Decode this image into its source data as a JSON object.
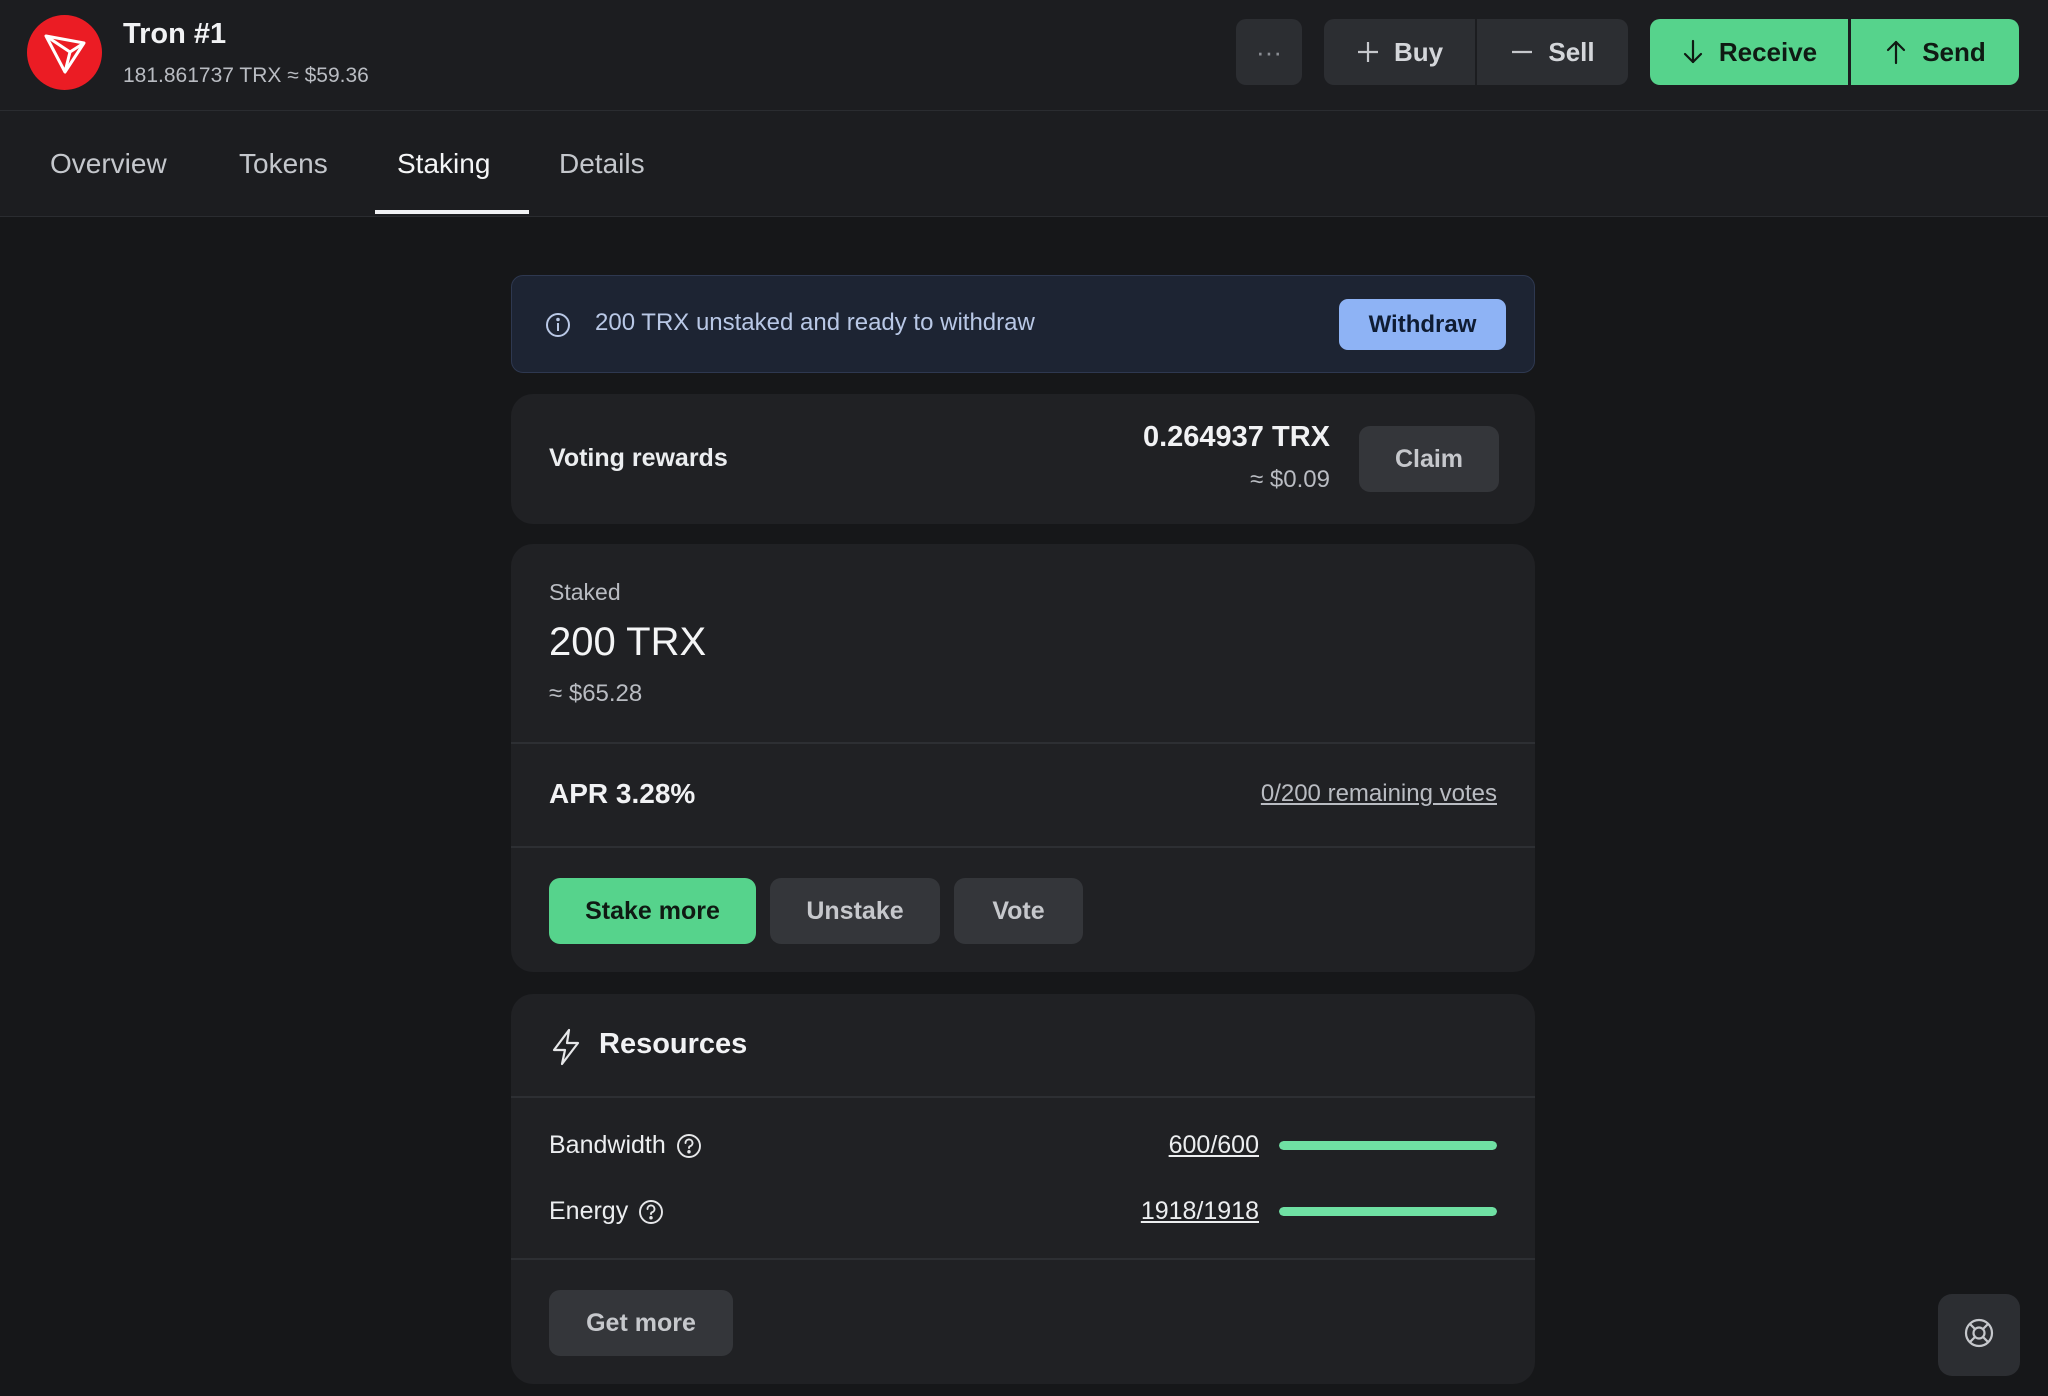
{
  "account": {
    "name": "Tron #1",
    "balance": "181.861737 TRX ≈ $59.36",
    "logo_icon": "tron-logo",
    "logo_color": "#eb1c24"
  },
  "header": {
    "more_label": "···",
    "buy_label": "Buy",
    "sell_label": "Sell",
    "receive_label": "Receive",
    "send_label": "Send"
  },
  "tabs": [
    {
      "label": "Overview",
      "active": false
    },
    {
      "label": "Tokens",
      "active": false
    },
    {
      "label": "Staking",
      "active": true
    },
    {
      "label": "Details",
      "active": false
    }
  ],
  "banner": {
    "text": "200 TRX unstaked and ready to withdraw",
    "button_label": "Withdraw"
  },
  "rewards": {
    "label": "Voting rewards",
    "amount": "0.264937 TRX",
    "usd": "≈ $0.09",
    "button_label": "Claim"
  },
  "staked": {
    "label": "Staked",
    "amount": "200 TRX",
    "usd": "≈ $65.28",
    "apr": "APR 3.28%",
    "votes_link": "0/200 remaining votes",
    "stake_more_label": "Stake more",
    "unstake_label": "Unstake",
    "vote_label": "Vote"
  },
  "resources": {
    "title": "Resources",
    "rows": [
      {
        "label": "Bandwidth",
        "value": "600/600",
        "fill_fraction": 1.0
      },
      {
        "label": "Energy",
        "value": "1918/1918",
        "fill_fraction": 1.0
      }
    ],
    "button_label": "Get more"
  },
  "colors": {
    "accent_green": "#56d38c",
    "bar_green": "#6fe0a3",
    "withdraw_blue": "#8eb3f5"
  }
}
